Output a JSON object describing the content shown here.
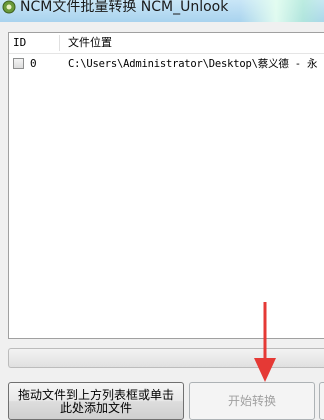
{
  "window": {
    "title": "NCM文件批量转换 NCM_Unlook"
  },
  "list": {
    "columns": [
      {
        "label": "ID"
      },
      {
        "label": "文件位置"
      }
    ],
    "rows": [
      {
        "checked": false,
        "id": "0",
        "path": "C:\\Users\\Administrator\\Desktop\\蔡义德 - 永"
      }
    ]
  },
  "progress": {
    "value": 0
  },
  "buttons": {
    "add_line1": "拖动文件到上方列表框或单击",
    "add_line2": "此处添加文件",
    "start": "开始转换"
  },
  "colors": {
    "annotation_arrow": "#e53935",
    "titlebar": "#b9ddf3",
    "progress_fill": "#06b025"
  }
}
